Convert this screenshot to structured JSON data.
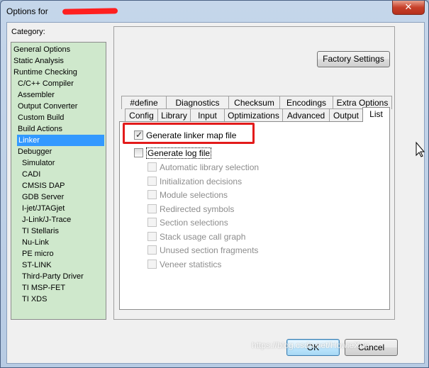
{
  "window": {
    "title": "Options for"
  },
  "category": {
    "label": "Category:",
    "items": [
      "General Options",
      "Static Analysis",
      "Runtime Checking",
      "C/C++ Compiler",
      "Assembler",
      "Output Converter",
      "Custom Build",
      "Build Actions",
      "Linker",
      "Debugger",
      "Simulator",
      "CADI",
      "CMSIS DAP",
      "GDB Server",
      "I-jet/JTAGjet",
      "J-Link/J-Trace",
      "TI Stellaris",
      "Nu-Link",
      "PE micro",
      "ST-LINK",
      "Third-Party Driver",
      "TI MSP-FET",
      "TI XDS"
    ],
    "selected": "Linker"
  },
  "panel": {
    "factory_settings": "Factory Settings",
    "tabs_row1": [
      "#define",
      "Diagnostics",
      "Checksum",
      "Encodings",
      "Extra Options"
    ],
    "tabs_row2": [
      "Config",
      "Library",
      "Input",
      "Optimizations",
      "Advanced",
      "Output",
      "List"
    ],
    "active_tab": "List",
    "options": {
      "linker_map": {
        "label": "Generate linker map file",
        "checked": true
      },
      "log_file": {
        "label": "Generate log file",
        "checked": false
      },
      "log_items": [
        "Automatic library selection",
        "Initialization decisions",
        "Module selections",
        "Redirected symbols",
        "Section selections",
        "Stack usage call graph",
        "Unused section fragments",
        "Veneer statistics"
      ]
    }
  },
  "buttons": {
    "ok": "OK",
    "cancel": "Cancel"
  },
  "watermark": "https://blog.csdn.net/HowieXue",
  "colors": {
    "category_bg": "#cfe8cc",
    "selection": "#3399ff",
    "highlight": "#e31b1b"
  }
}
